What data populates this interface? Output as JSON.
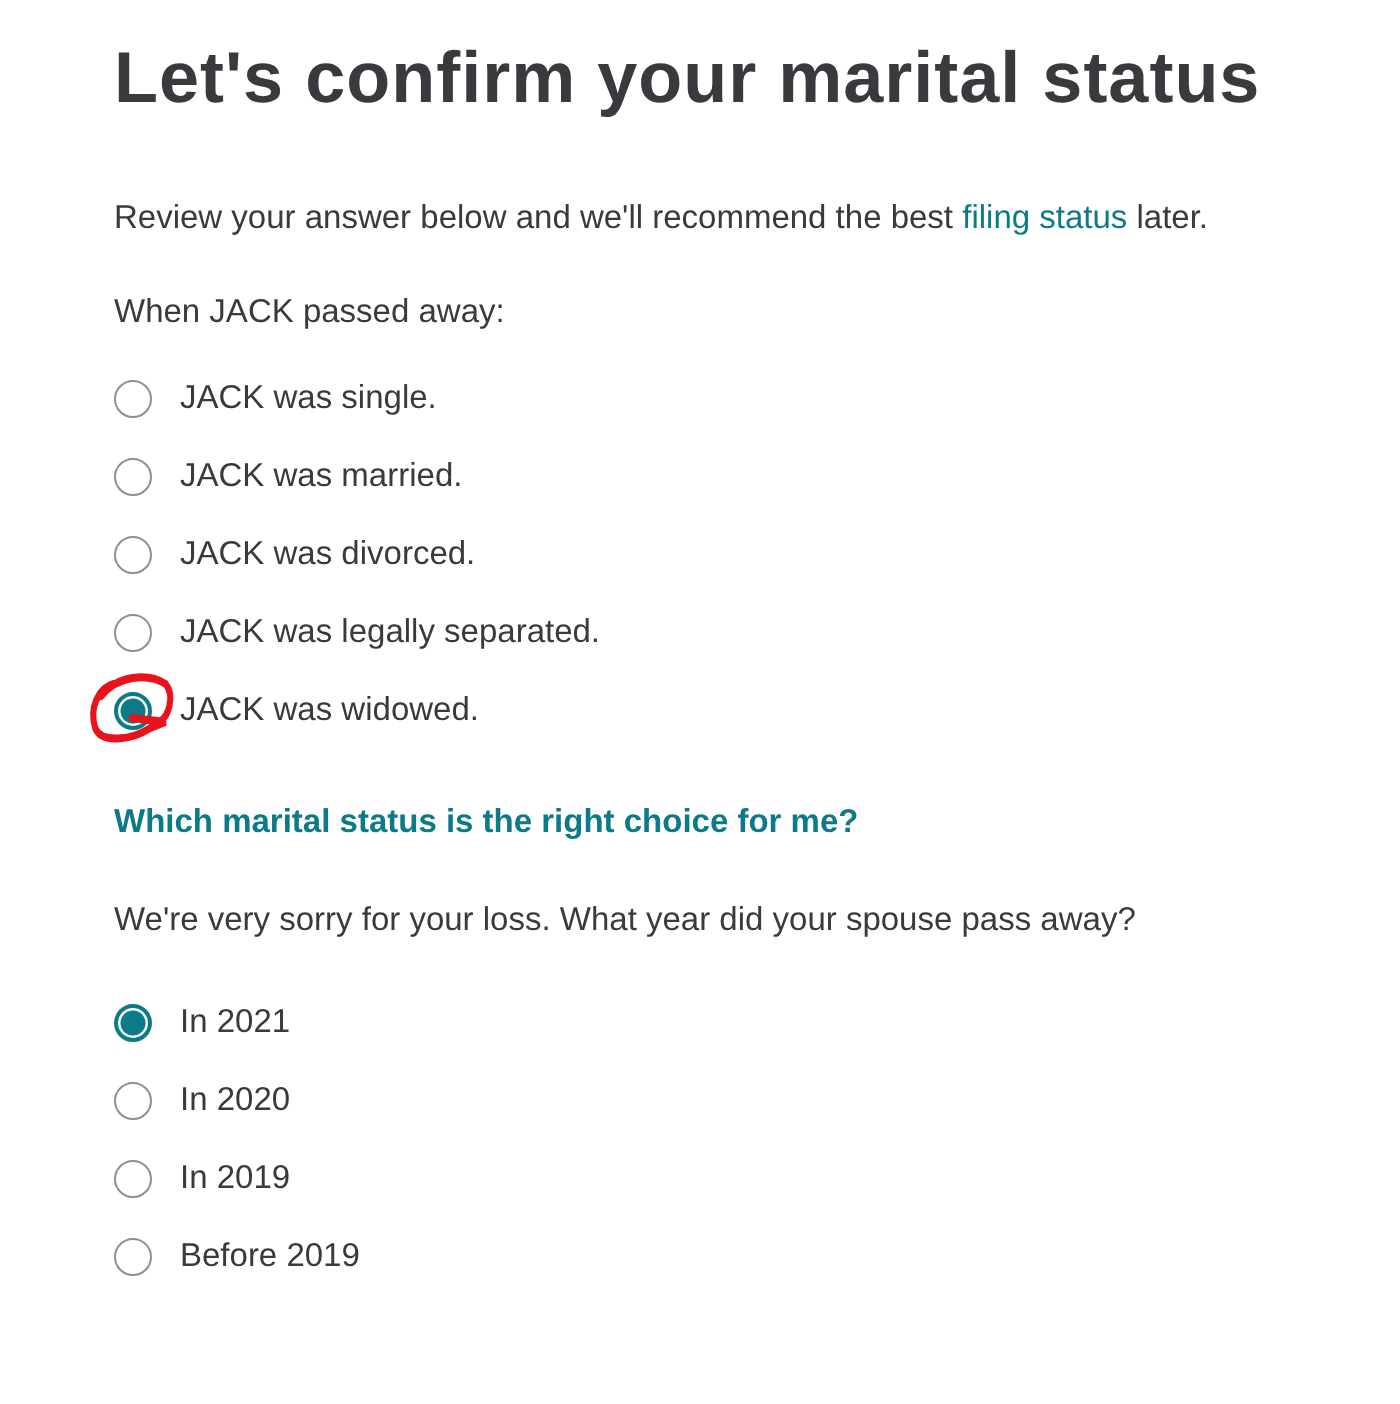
{
  "title": "Let's confirm your marital status",
  "intro": {
    "before": "Review your answer below and we'll recommend the best ",
    "link": "filing status",
    "after": " later."
  },
  "question": "When JACK passed away:",
  "status_options": [
    {
      "label": "JACK was single.",
      "selected": false
    },
    {
      "label": "JACK was married.",
      "selected": false
    },
    {
      "label": "JACK was divorced.",
      "selected": false
    },
    {
      "label": "JACK was legally separated.",
      "selected": false
    },
    {
      "label": "JACK was widowed.",
      "selected": true
    }
  ],
  "help_link": "Which marital status is the right choice for me?",
  "year_question": "We're very sorry for your loss. What year did your spouse pass away?",
  "year_options": [
    {
      "label": "In 2021",
      "selected": true
    },
    {
      "label": "In 2020",
      "selected": false
    },
    {
      "label": "In 2019",
      "selected": false
    },
    {
      "label": "Before 2019",
      "selected": false
    }
  ]
}
